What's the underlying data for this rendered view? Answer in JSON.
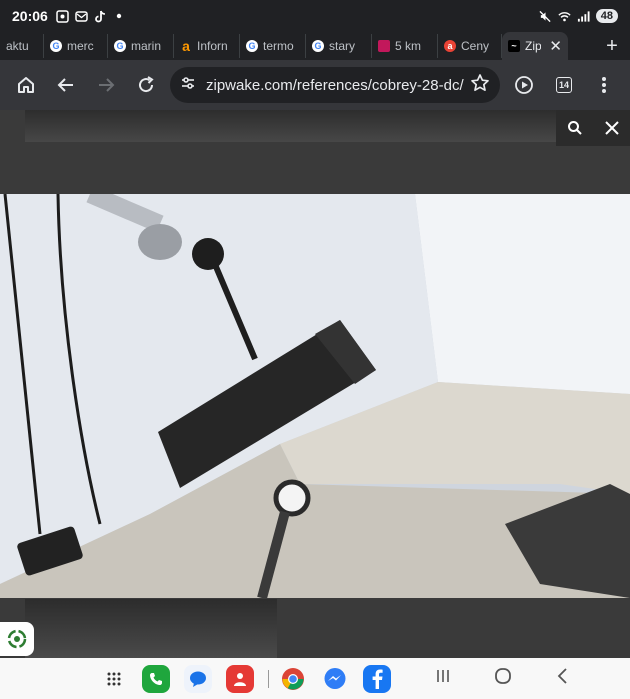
{
  "status_bar": {
    "time": "20:06",
    "battery": "48"
  },
  "tabs": [
    {
      "label": "aktu",
      "favicon": "none"
    },
    {
      "label": "merc",
      "favicon": "google"
    },
    {
      "label": "marin",
      "favicon": "google"
    },
    {
      "label": "Inforn",
      "favicon": "amazon"
    },
    {
      "label": "termo",
      "favicon": "google"
    },
    {
      "label": "stary",
      "favicon": "google"
    },
    {
      "label": "5 km",
      "favicon": "image"
    },
    {
      "label": "Ceny",
      "favicon": "red"
    },
    {
      "label": "Zip",
      "favicon": "dark",
      "active": true
    }
  ],
  "toolbar": {
    "url": "zipwake.com/references/cobrey-28-dc/",
    "tab_count": "14"
  },
  "photo": {
    "description_colors": {
      "sky": "#e9edf3",
      "hull": "#eef0f3",
      "deck": "#d8d4cc",
      "dark": "#1e1e1e"
    }
  }
}
